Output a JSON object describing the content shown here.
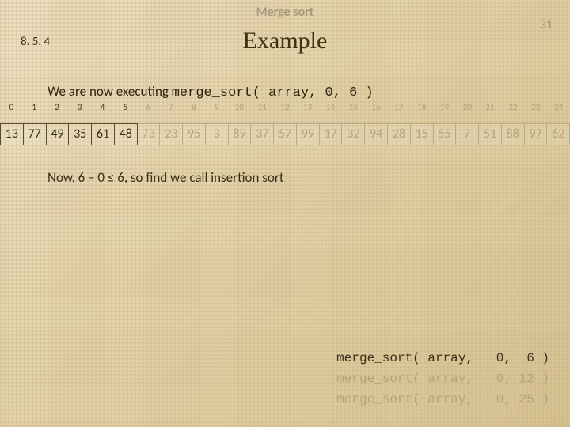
{
  "header": "Merge sort",
  "page_number": "31",
  "section": "8. 5. 4",
  "title": "Example",
  "exec_line_prefix": "We are now executing ",
  "exec_call": "merge_sort( array, 0,  6 )",
  "highlight_end": 5,
  "indices": [
    "0",
    "1",
    "2",
    "3",
    "4",
    "5",
    "6",
    "7",
    "8",
    "9",
    "10",
    "11",
    "12",
    "13",
    "14",
    "15",
    "16",
    "17",
    "18",
    "19",
    "20",
    "21",
    "22",
    "23",
    "24"
  ],
  "values": [
    "13",
    "77",
    "49",
    "35",
    "61",
    "48",
    "73",
    "23",
    "95",
    "3",
    "89",
    "37",
    "57",
    "99",
    "17",
    "32",
    "94",
    "28",
    "15",
    "55",
    "7",
    "51",
    "88",
    "97",
    "62"
  ],
  "now_prefix": "Now, ",
  "now_math": "6 – 0 ≤ 6",
  "now_suffix": ", so find we call insertion sort",
  "stack": [
    {
      "fn": "merge_sort( array,",
      "a": "0,",
      "b": " 6 )",
      "dim": false
    },
    {
      "fn": "merge_sort( array,",
      "a": "0,",
      "b": "12 )",
      "dim": true
    },
    {
      "fn": "merge_sort( array,",
      "a": "0,",
      "b": "25 )",
      "dim": true
    }
  ]
}
